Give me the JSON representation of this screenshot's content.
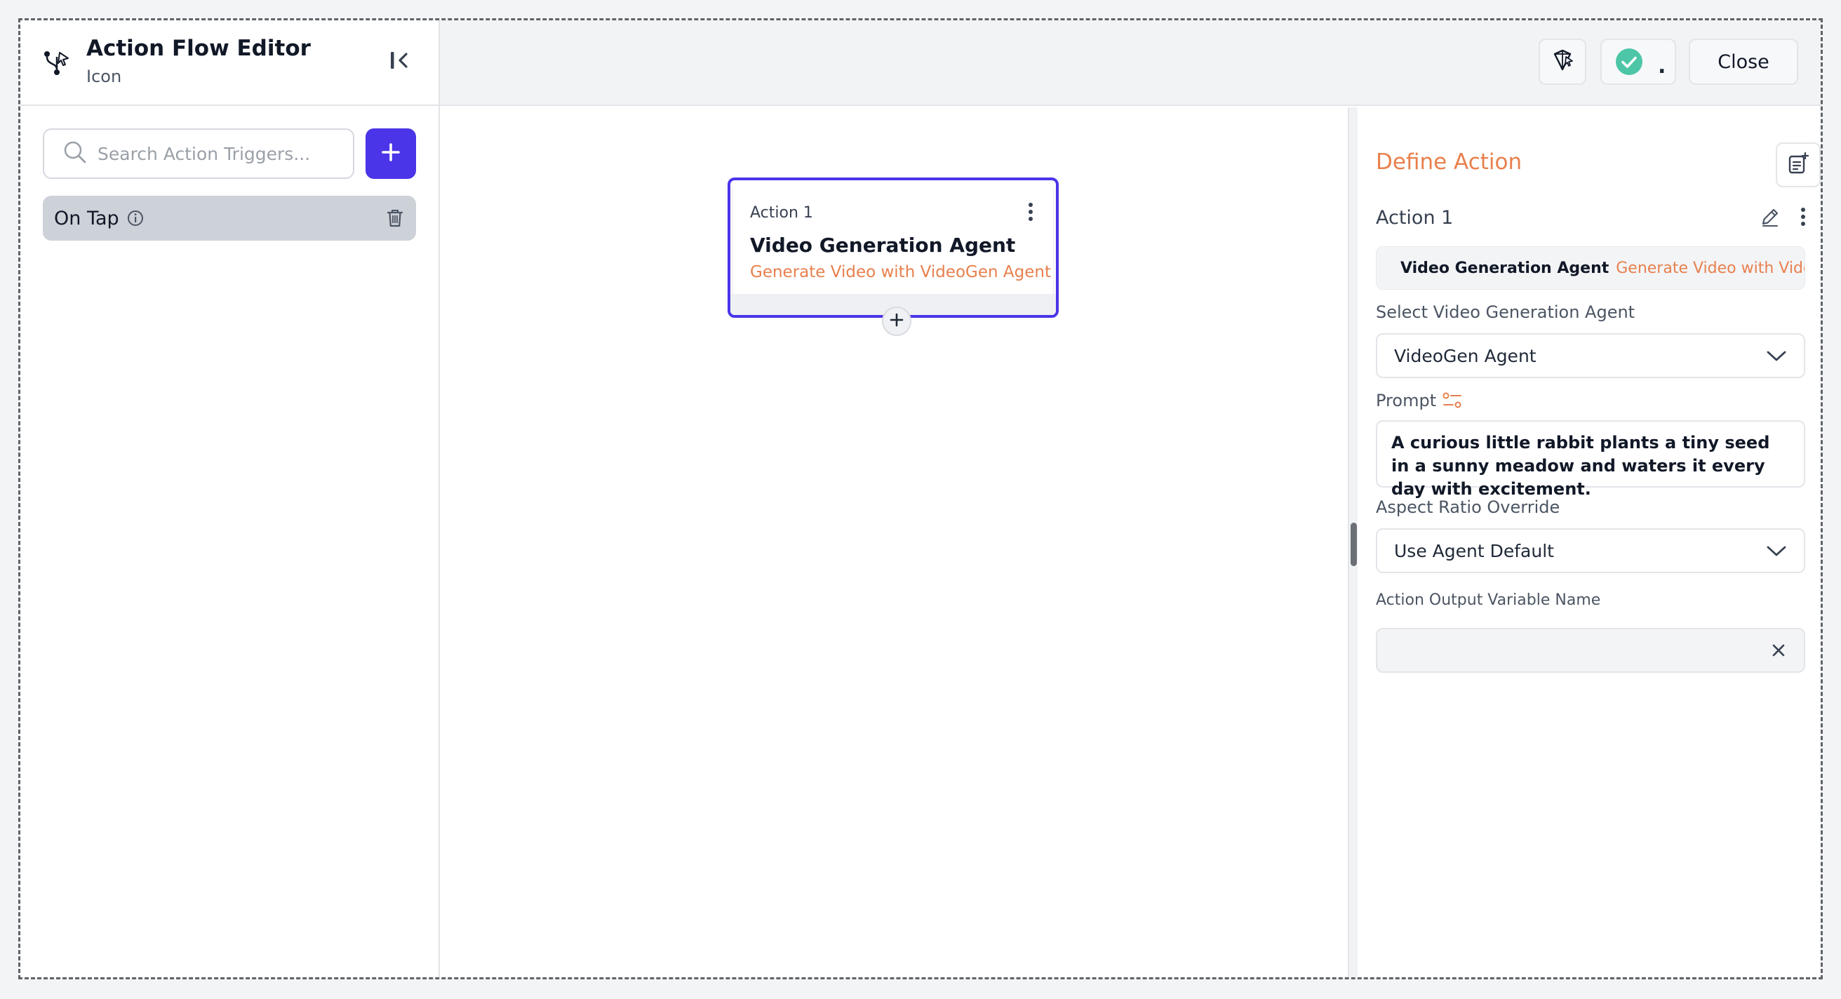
{
  "header": {
    "title": "Action Flow Editor",
    "subtitle": "Icon",
    "icon": "flow-branch-icon",
    "close_label": "Close",
    "status_dot": "."
  },
  "sidebar": {
    "search_placeholder": "Search Action Triggers...",
    "triggers": [
      {
        "label": "On Tap",
        "icon": "info-icon"
      }
    ]
  },
  "canvas": {
    "card": {
      "label": "Action 1",
      "title": "Video Generation Agent",
      "subtitle": "Generate Video with VideoGen Agent"
    }
  },
  "panel": {
    "title": "Define Action",
    "action_name": "Action 1",
    "summary_agent": "Video Generation Agent",
    "summary_desc": "Generate Video with VideoGen Agent",
    "select_agent_label": "Select Video Generation Agent",
    "select_agent_value": "VideoGen Agent",
    "prompt_label": "Prompt",
    "prompt_text": "A curious little rabbit plants a tiny seed in a sunny meadow and waters it every day with excitement.",
    "aspect_label": "Aspect Ratio Override",
    "aspect_value": "Use Agent Default",
    "output_label": "Action Output Variable Name",
    "output_value": ""
  },
  "colors": {
    "accent": "#4a35e8",
    "orange": "#e8804d",
    "success": "#4cc6a6",
    "selected_bg": "#cdd1d8"
  }
}
